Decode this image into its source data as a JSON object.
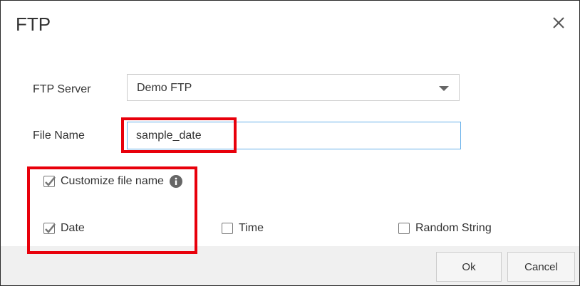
{
  "dialog": {
    "title": "FTP",
    "close_icon": "close-icon"
  },
  "form": {
    "ftp_server": {
      "label": "FTP Server",
      "selected_value": "Demo FTP"
    },
    "file_name": {
      "label": "File Name",
      "value": "sample_date"
    },
    "customize": {
      "label": "Customize file name",
      "checked": true,
      "info_icon": "info-icon"
    },
    "options": [
      {
        "label": "Date",
        "checked": true
      },
      {
        "label": "Time",
        "checked": false
      },
      {
        "label": "Random String",
        "checked": false
      }
    ]
  },
  "footer": {
    "ok_label": "Ok",
    "cancel_label": "Cancel"
  },
  "colors": {
    "highlight": "#e8000b",
    "input_focus_border": "#66afe9"
  }
}
